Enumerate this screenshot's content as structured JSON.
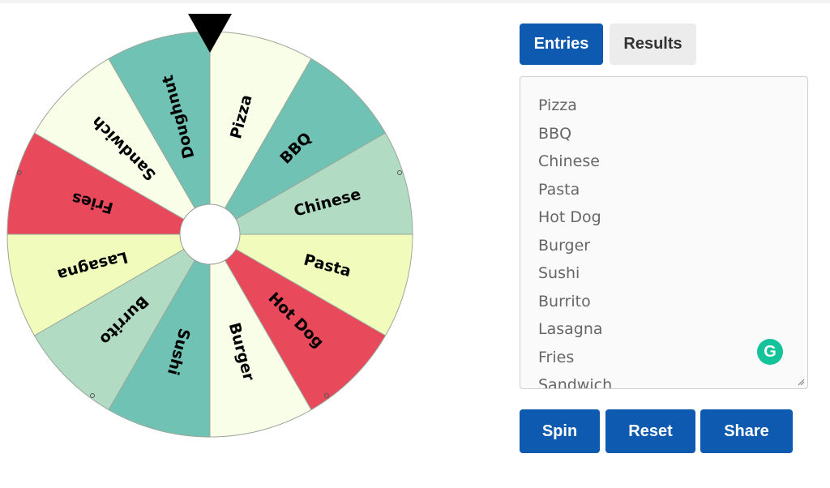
{
  "wheel": {
    "entries": [
      {
        "label": "Pizza",
        "color": "#f8fee8"
      },
      {
        "label": "BBQ",
        "color": "#70c2b4"
      },
      {
        "label": "Chinese",
        "color": "#b1dcc3"
      },
      {
        "label": "Pasta",
        "color": "#f1fbbc"
      },
      {
        "label": "Hot Dog",
        "color": "#e8495b"
      },
      {
        "label": "Burger",
        "color": "#f8fee8"
      },
      {
        "label": "Sushi",
        "color": "#70c2b4"
      },
      {
        "label": "Burrito",
        "color": "#b1dcc3"
      },
      {
        "label": "Lasagna",
        "color": "#f1fbbc"
      },
      {
        "label": "Fries",
        "color": "#e8495b"
      },
      {
        "label": "Sandwich",
        "color": "#f8fee8"
      },
      {
        "label": "Doughnut",
        "color": "#70c2b4"
      }
    ],
    "border_color": "#9aa79a",
    "pointer_color": "#000000"
  },
  "tabs": {
    "entries_label": "Entries",
    "results_label": "Results"
  },
  "entries_list": [
    "Pizza",
    "BBQ",
    "Chinese",
    "Pasta",
    "Hot Dog",
    "Burger",
    "Sushi",
    "Burrito",
    "Lasagna",
    "Fries",
    "Sandwich"
  ],
  "buttons": {
    "spin": "Spin",
    "reset": "Reset",
    "share": "Share"
  },
  "colors": {
    "primary": "#0e5ab0",
    "grammarly": "#15c39a"
  }
}
